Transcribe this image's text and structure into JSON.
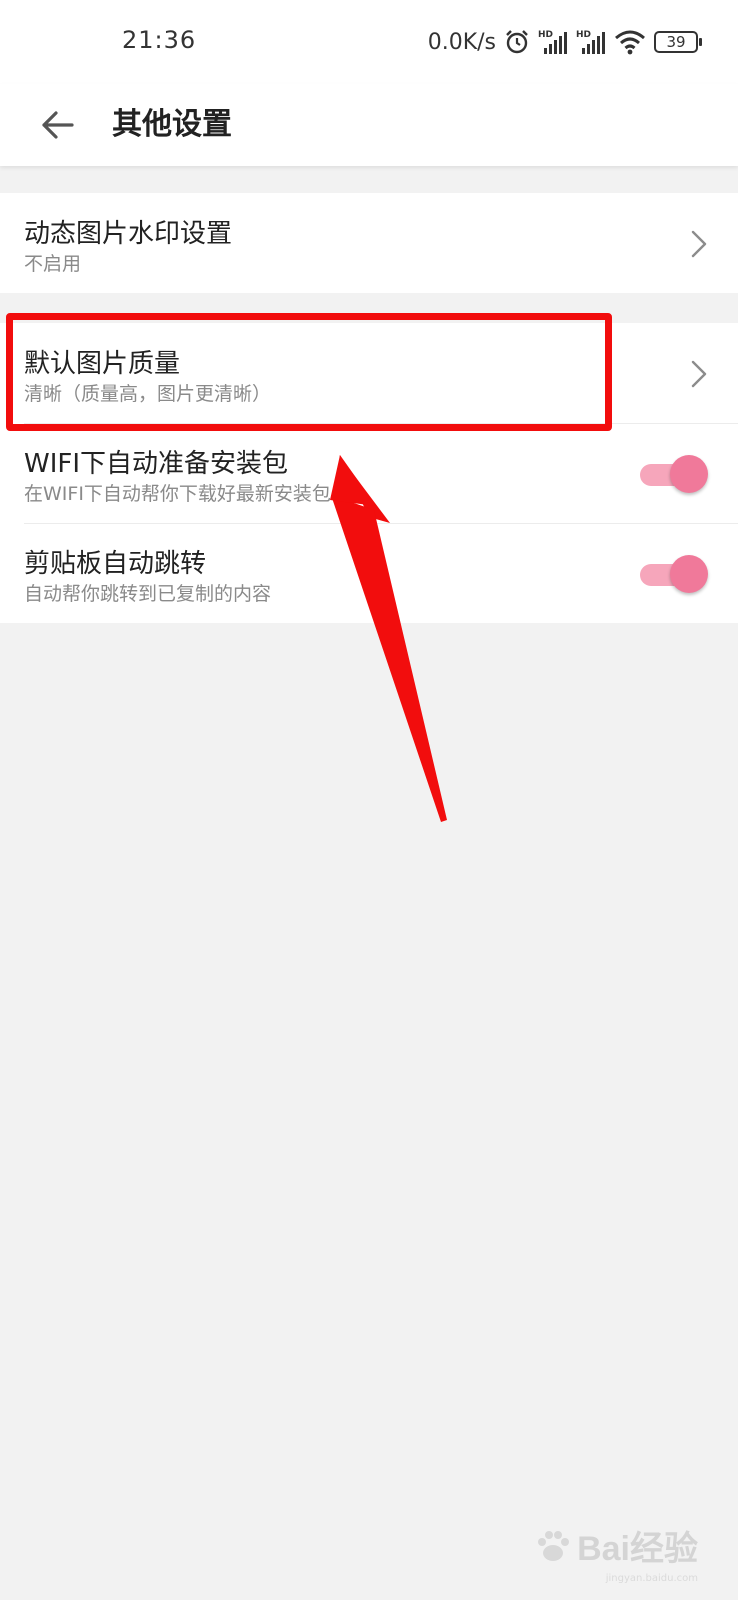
{
  "status_bar": {
    "time": "21:36",
    "net_speed": "0.0K/s",
    "battery": "39",
    "icons": [
      "alarm-icon",
      "hd-signal-icon",
      "hd-signal-icon",
      "wifi-icon",
      "battery-icon"
    ]
  },
  "toolbar": {
    "title": "其他设置",
    "back_icon": "back-arrow-icon"
  },
  "settings": {
    "watermark": {
      "title": "动态图片水印设置",
      "subtitle": "不启用"
    },
    "quality": {
      "title": "默认图片质量",
      "subtitle": "清晰（质量高，图片更清晰）"
    },
    "wifi_prepare": {
      "title": "WIFI下自动准备安装包",
      "subtitle": "在WIFI下自动帮你下载好最新安装包",
      "enabled": true
    },
    "clipboard_jump": {
      "title": "剪贴板自动跳转",
      "subtitle": "自动帮你跳转到已复制的内容",
      "enabled": true
    }
  },
  "colors": {
    "accent": "#f0799a",
    "accent_track": "#f6a6bb",
    "annotation_red": "#f20d0d",
    "background": "#f2f2f2"
  },
  "watermark_logo": {
    "text": "Bai经验",
    "sub": "jingyan.baidu.com"
  }
}
